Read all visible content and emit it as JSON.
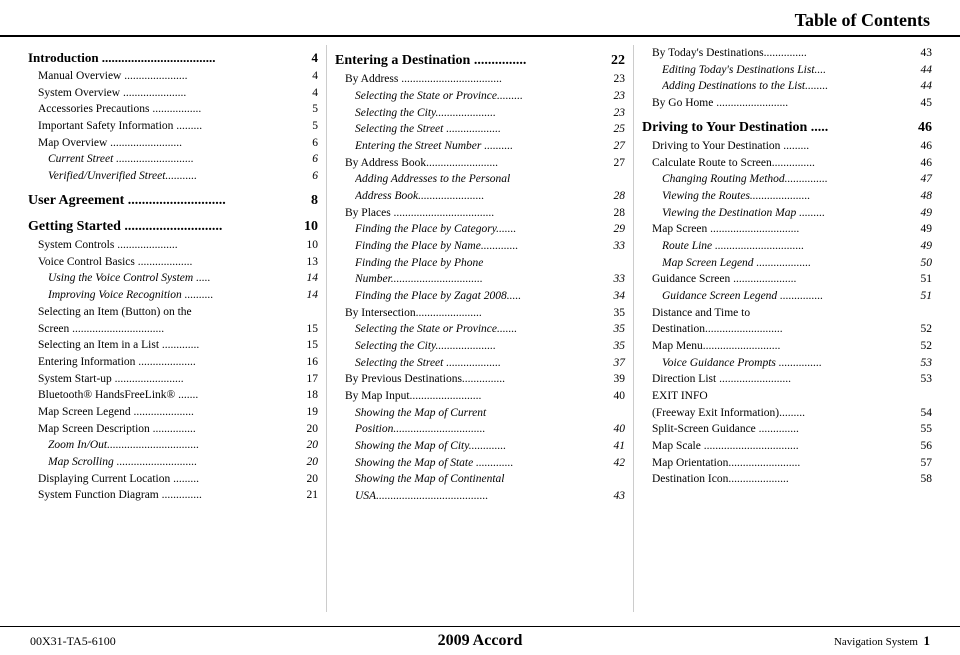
{
  "header": {
    "title": "Table of Contents"
  },
  "footer": {
    "left": "00X31-TA5-6100",
    "center": "2009  Accord",
    "right_label": "Navigation System",
    "right_page": "1"
  },
  "columns": {
    "left": {
      "sections": [
        {
          "type": "section-title",
          "label": "Introduction ",
          "dotfill": "...................................",
          "page": "4"
        },
        {
          "type": "entry",
          "indent": 1,
          "label": "Manual Overview ",
          "dotfill": "......................",
          "page": "4"
        },
        {
          "type": "entry",
          "indent": 1,
          "label": "System Overview ",
          "dotfill": "......................",
          "page": "4"
        },
        {
          "type": "entry",
          "indent": 1,
          "label": "Accessories Precautions ",
          "dotfill": ".................",
          "page": "5"
        },
        {
          "type": "entry",
          "indent": 1,
          "label": "Important Safety Information ",
          "dotfill": ".........",
          "page": "5"
        },
        {
          "type": "entry",
          "indent": 1,
          "label": "Map Overview ",
          "dotfill": ".........................",
          "page": "6"
        },
        {
          "type": "entry",
          "indent": 2,
          "label": "Current Street ",
          "dotfill": "...........................",
          "page": "6"
        },
        {
          "type": "entry",
          "indent": 2,
          "label": "Verified/Unverified Street",
          "dotfill": "...........",
          "page": "6"
        },
        {
          "type": "section-title-lg",
          "label": "User Agreement ",
          "dotfill": "............................",
          "page": "8"
        },
        {
          "type": "section-title-lg",
          "label": "Getting Started ",
          "dotfill": "............................",
          "page": "10"
        },
        {
          "type": "entry",
          "indent": 1,
          "label": "System Controls ",
          "dotfill": ".....................",
          "page": "10"
        },
        {
          "type": "entry",
          "indent": 1,
          "label": "Voice Control Basics ",
          "dotfill": "...................",
          "page": "13"
        },
        {
          "type": "entry",
          "indent": 2,
          "label": "Using the Voice Control System ",
          "dotfill": ".....",
          "page": "14"
        },
        {
          "type": "entry",
          "indent": 2,
          "label": "Improving Voice Recognition ",
          "dotfill": "..........",
          "page": "14"
        },
        {
          "type": "entry",
          "indent": 1,
          "label": "Selecting an Item (Button) on the",
          "dotfill": "",
          "page": ""
        },
        {
          "type": "entry",
          "indent": 1,
          "label": "  Screen ",
          "dotfill": "................................",
          "page": "15"
        },
        {
          "type": "entry",
          "indent": 1,
          "label": "Selecting an Item in a List ",
          "dotfill": ".............",
          "page": "15"
        },
        {
          "type": "entry",
          "indent": 1,
          "label": "Entering Information ",
          "dotfill": "....................",
          "page": "16"
        },
        {
          "type": "entry",
          "indent": 1,
          "label": "System Start-up ",
          "dotfill": "........................",
          "page": "17"
        },
        {
          "type": "entry",
          "indent": 1,
          "label": "Bluetooth® HandsFreeLink® ",
          "dotfill": ".......",
          "page": "18"
        },
        {
          "type": "entry",
          "indent": 1,
          "label": "Map Screen Legend ",
          "dotfill": ".....................",
          "page": "19"
        },
        {
          "type": "entry",
          "indent": 1,
          "label": "Map Screen Description ",
          "dotfill": "...............",
          "page": "20"
        },
        {
          "type": "entry",
          "indent": 2,
          "label": "Zoom In/Out",
          "dotfill": "................................",
          "page": "20"
        },
        {
          "type": "entry",
          "indent": 2,
          "label": "Map Scrolling ",
          "dotfill": "............................",
          "page": "20"
        },
        {
          "type": "entry",
          "indent": 1,
          "label": "Displaying Current Location ",
          "dotfill": ".........",
          "page": "20"
        },
        {
          "type": "entry",
          "indent": 1,
          "label": "System Function Diagram ",
          "dotfill": "..............",
          "page": "21"
        }
      ]
    },
    "mid": {
      "sections": [
        {
          "type": "section-title-lg",
          "label": "Entering a Destination ",
          "dotfill": "...............",
          "page": "22"
        },
        {
          "type": "entry",
          "indent": 1,
          "label": "By Address ",
          "dotfill": "...................................",
          "page": "23"
        },
        {
          "type": "entry",
          "indent": 2,
          "label": "Selecting the State or Province",
          "dotfill": ".........",
          "page": "23"
        },
        {
          "type": "entry",
          "indent": 2,
          "label": "Selecting the City",
          "dotfill": ".....................",
          "page": "23"
        },
        {
          "type": "entry",
          "indent": 2,
          "label": "Selecting the Street ",
          "dotfill": "...................",
          "page": "25"
        },
        {
          "type": "entry",
          "indent": 2,
          "label": "Entering the Street Number ",
          "dotfill": "..........",
          "page": "27"
        },
        {
          "type": "entry",
          "indent": 1,
          "label": "By Address Book",
          "dotfill": ".........................",
          "page": "27"
        },
        {
          "type": "entry",
          "indent": 2,
          "label": "Adding Addresses to the Personal",
          "dotfill": "",
          "page": ""
        },
        {
          "type": "entry",
          "indent": 2,
          "label": "  Address Book",
          "dotfill": ".......................",
          "page": "28"
        },
        {
          "type": "entry",
          "indent": 1,
          "label": "By Places ",
          "dotfill": "...................................",
          "page": "28"
        },
        {
          "type": "entry",
          "indent": 2,
          "label": "Finding the Place by Category",
          "dotfill": ".......",
          "page": "29"
        },
        {
          "type": "entry",
          "indent": 2,
          "label": "Finding the Place by Name",
          "dotfill": ".............",
          "page": "33"
        },
        {
          "type": "entry",
          "indent": 2,
          "label": "Finding the Place by Phone",
          "dotfill": "",
          "page": ""
        },
        {
          "type": "entry",
          "indent": 2,
          "label": "  Number",
          "dotfill": "................................",
          "page": "33"
        },
        {
          "type": "entry",
          "indent": 2,
          "label": "Finding the Place by Zagat 2008",
          "dotfill": ".....",
          "page": "34"
        },
        {
          "type": "entry",
          "indent": 1,
          "label": "By Intersection",
          "dotfill": ".......................",
          "page": "35"
        },
        {
          "type": "entry",
          "indent": 2,
          "label": "Selecting the State or Province",
          "dotfill": ".......",
          "page": "35"
        },
        {
          "type": "entry",
          "indent": 2,
          "label": "Selecting the City",
          "dotfill": ".....................",
          "page": "35"
        },
        {
          "type": "entry",
          "indent": 2,
          "label": "Selecting the Street ",
          "dotfill": "...................",
          "page": "37"
        },
        {
          "type": "entry",
          "indent": 1,
          "label": "By Previous Destinations",
          "dotfill": "...............",
          "page": "39"
        },
        {
          "type": "entry",
          "indent": 1,
          "label": "By Map Input",
          "dotfill": ".........................",
          "page": "40"
        },
        {
          "type": "entry",
          "indent": 2,
          "label": "Showing the Map of Current",
          "dotfill": "",
          "page": ""
        },
        {
          "type": "entry",
          "indent": 2,
          "label": "  Position",
          "dotfill": "................................",
          "page": "40"
        },
        {
          "type": "entry",
          "indent": 2,
          "label": "Showing the Map of City",
          "dotfill": ".............",
          "page": "41"
        },
        {
          "type": "entry",
          "indent": 2,
          "label": "Showing the Map of State ",
          "dotfill": ".............",
          "page": "42"
        },
        {
          "type": "entry",
          "indent": 2,
          "label": "Showing the Map of Continental",
          "dotfill": "",
          "page": ""
        },
        {
          "type": "entry",
          "indent": 2,
          "label": "  USA",
          "dotfill": ".......................................",
          "page": "43"
        }
      ]
    },
    "right": {
      "sections": [
        {
          "type": "entry",
          "indent": 1,
          "label": "By Today's Destinations",
          "dotfill": "...............",
          "page": "43"
        },
        {
          "type": "entry",
          "indent": 2,
          "label": "Editing Today's Destinations List",
          "dotfill": "....",
          "page": "44"
        },
        {
          "type": "entry",
          "indent": 2,
          "label": "Adding Destinations to the List",
          "dotfill": "........",
          "page": "44"
        },
        {
          "type": "entry",
          "indent": 1,
          "label": "By Go Home ",
          "dotfill": ".........................",
          "page": "45"
        },
        {
          "type": "section-title-lg",
          "label": "Driving to Your Destination ",
          "dotfill": ".....",
          "page": "46"
        },
        {
          "type": "entry",
          "indent": 1,
          "label": "Driving to Your Destination ",
          "dotfill": ".........",
          "page": "46"
        },
        {
          "type": "entry",
          "indent": 1,
          "label": "Calculate Route to Screen",
          "dotfill": "...............",
          "page": "46"
        },
        {
          "type": "entry",
          "indent": 2,
          "label": "Changing Routing Method",
          "dotfill": "...............",
          "page": "47"
        },
        {
          "type": "entry",
          "indent": 2,
          "label": "Viewing the Routes",
          "dotfill": ".....................",
          "page": "48"
        },
        {
          "type": "entry",
          "indent": 2,
          "label": "Viewing the Destination Map ",
          "dotfill": ".........",
          "page": "49"
        },
        {
          "type": "entry",
          "indent": 1,
          "label": "Map Screen ",
          "dotfill": "...............................",
          "page": "49"
        },
        {
          "type": "entry",
          "indent": 2,
          "label": "Route Line ",
          "dotfill": "...............................",
          "page": "49"
        },
        {
          "type": "entry",
          "indent": 2,
          "label": "Map Screen Legend ",
          "dotfill": "...................",
          "page": "50"
        },
        {
          "type": "entry",
          "indent": 1,
          "label": "Guidance Screen ",
          "dotfill": "......................",
          "page": "51"
        },
        {
          "type": "entry",
          "indent": 2,
          "label": "Guidance Screen Legend ",
          "dotfill": "...............",
          "page": "51"
        },
        {
          "type": "entry",
          "indent": 1,
          "label": "Distance and Time to",
          "dotfill": "",
          "page": ""
        },
        {
          "type": "entry",
          "indent": 1,
          "label": "  Destination",
          "dotfill": "...........................",
          "page": "52"
        },
        {
          "type": "entry",
          "indent": 1,
          "label": "Map Menu",
          "dotfill": "...........................",
          "page": "52"
        },
        {
          "type": "entry",
          "indent": 2,
          "label": "Voice Guidance Prompts ",
          "dotfill": "...............",
          "page": "53"
        },
        {
          "type": "entry",
          "indent": 1,
          "label": "Direction List ",
          "dotfill": ".........................",
          "page": "53"
        },
        {
          "type": "entry",
          "indent": 1,
          "label": "EXIT INFO",
          "dotfill": "",
          "page": ""
        },
        {
          "type": "entry",
          "indent": 1,
          "label": "  (Freeway Exit Information)",
          "dotfill": ".........",
          "page": "54"
        },
        {
          "type": "entry",
          "indent": 1,
          "label": "Split-Screen Guidance ",
          "dotfill": "..............",
          "page": "55"
        },
        {
          "type": "entry",
          "indent": 1,
          "label": "Map Scale ",
          "dotfill": ".................................",
          "page": "56"
        },
        {
          "type": "entry",
          "indent": 1,
          "label": "Map Orientation",
          "dotfill": ".........................",
          "page": "57"
        },
        {
          "type": "entry",
          "indent": 1,
          "label": "Destination Icon",
          "dotfill": ".....................",
          "page": "58"
        }
      ]
    }
  }
}
